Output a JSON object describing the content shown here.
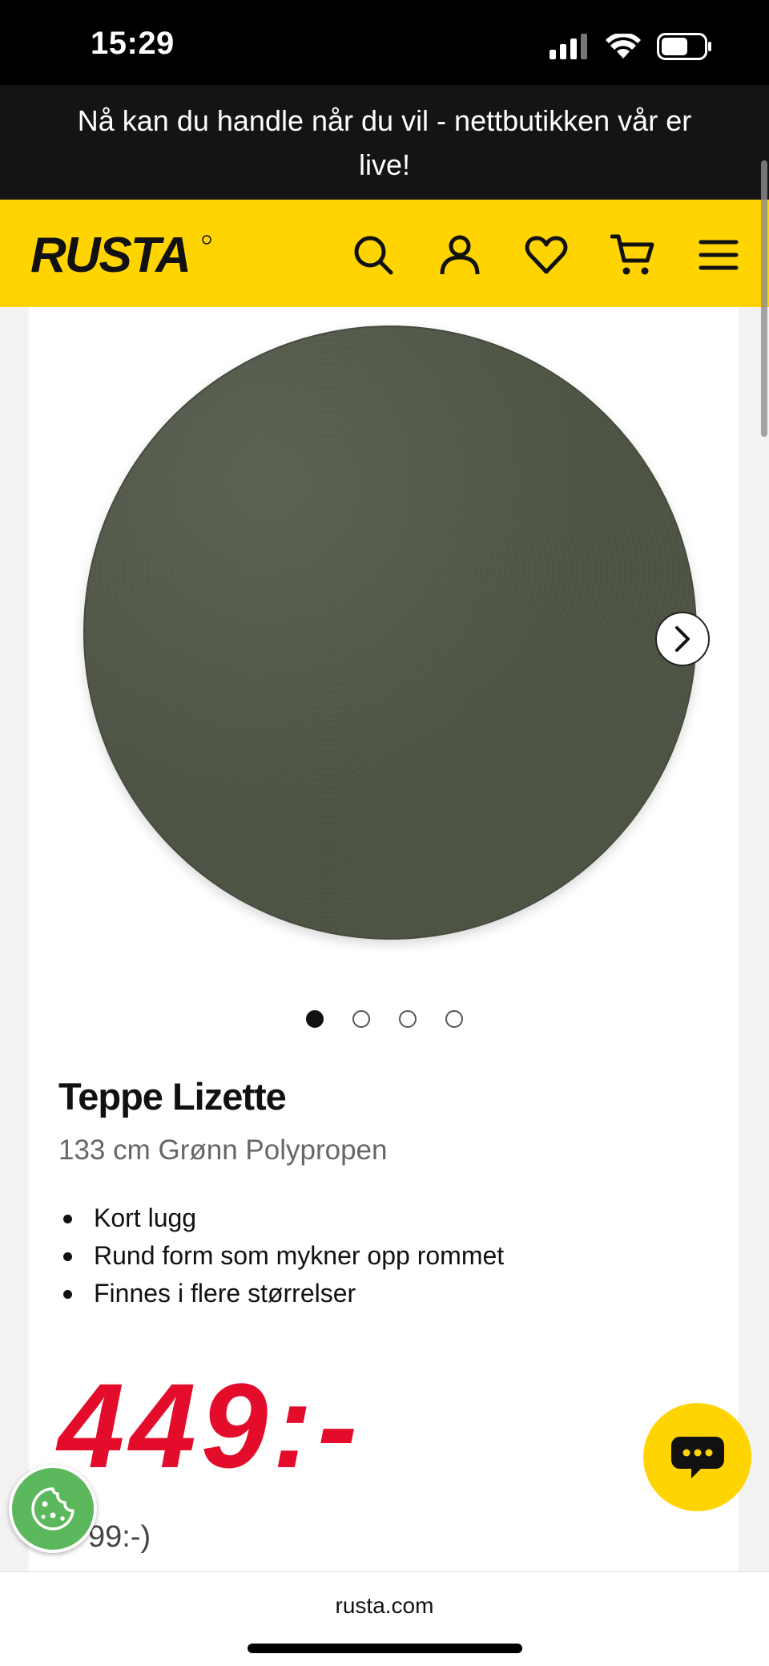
{
  "status_bar": {
    "time": "15:29"
  },
  "banner": {
    "text": "Nå kan du handle når du vil - nettbutikken vår er live!"
  },
  "header": {
    "logo_text": "RUSTA",
    "icons": [
      "search-icon",
      "user-icon",
      "heart-icon",
      "cart-icon",
      "menu-icon"
    ]
  },
  "gallery": {
    "slide_count": 4,
    "active_slide": 1
  },
  "product": {
    "title": "Teppe Lizette",
    "subtitle": "133 cm Grønn Polypropen",
    "features": [
      "Kort lugg",
      "Rund form som mykner opp rommet",
      "Finnes i flere størrelser"
    ],
    "price": "449:-",
    "old_price_visible": "99:-)"
  },
  "browser": {
    "url": "rusta.com"
  },
  "colors": {
    "brand_yellow": "#ffd400",
    "price_red": "#e30d2b",
    "cookie_green": "#5cb85c",
    "rug_green": "#4f5546"
  }
}
